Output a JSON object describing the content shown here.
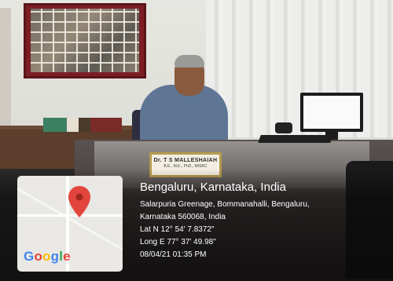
{
  "nameplate": {
    "name": "Dr. T S MALLESHAIAH",
    "degrees": "B.E., M.E., PhD., MISRC"
  },
  "geotag": {
    "title": "Bengaluru, Karnataka, India",
    "address_line1": "Salarpuria Greenage, Bommanahalli, Bengaluru,",
    "address_line2": "Karnataka 560068, India",
    "latitude": "Lat N 12° 54' 7.8372\"",
    "longitude": "Long E 77° 37' 49.98\"",
    "datetime": "08/04/21 01:35 PM",
    "map_icon": "map-pin-icon"
  },
  "map_brand": {
    "letters": [
      "G",
      "o",
      "o",
      "g",
      "l",
      "e"
    ],
    "colors": [
      "#4285F4",
      "#EA4335",
      "#FBBC05",
      "#4285F4",
      "#34A853",
      "#EA4335"
    ]
  },
  "colors": {
    "pin": "#e2453c",
    "overlay_text": "#ffffff"
  }
}
